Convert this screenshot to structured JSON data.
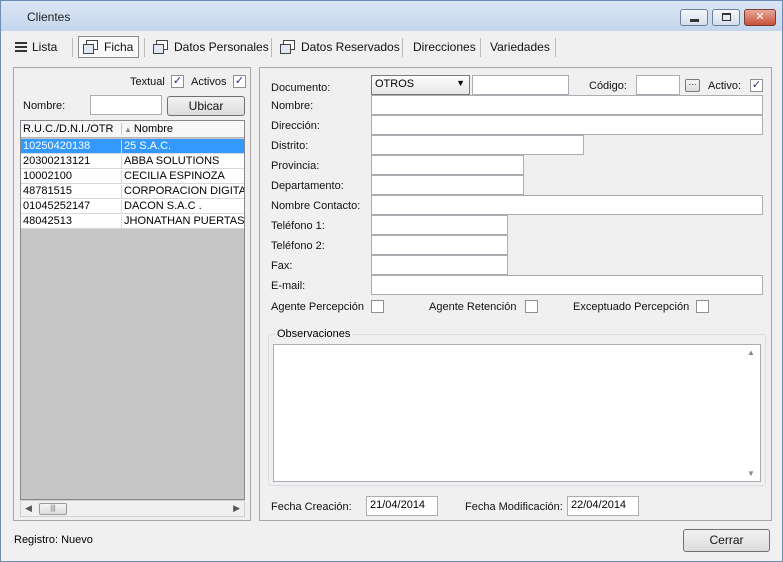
{
  "window": {
    "title": "Clientes"
  },
  "toolbar": {
    "tabs": [
      {
        "label": "Lista"
      },
      {
        "label": "Ficha"
      },
      {
        "label": "Datos Personales"
      },
      {
        "label": "Datos Reservados"
      },
      {
        "label": "Direcciones"
      },
      {
        "label": "Variedades"
      }
    ]
  },
  "search": {
    "textual_label": "Textual",
    "textual_checked": "✓",
    "activos_label": "Activos",
    "activos_checked": "✓",
    "nombre_label": "Nombre:",
    "nombre_value": "",
    "ubicar_label": "Ubicar"
  },
  "grid": {
    "columns": [
      "R.U.C./D.N.I./OTR",
      "Nombre"
    ],
    "sort_glyph": "▲",
    "rows": [
      {
        "doc": "10250420138",
        "name": "25 S.A.C."
      },
      {
        "doc": "20300213121",
        "name": "ABBA SOLUTIONS"
      },
      {
        "doc": "10002100",
        "name": "CECILIA ESPINOZA"
      },
      {
        "doc": "48781515",
        "name": "CORPORACION DIGITAX"
      },
      {
        "doc": "01045252147",
        "name": "DACON S.A.C ."
      },
      {
        "doc": "48042513",
        "name": "JHONATHAN PUERTAS"
      }
    ],
    "selected_index": 0
  },
  "form": {
    "documento_label": "Documento:",
    "documento_value": "OTROS",
    "documento_number": "",
    "codigo_label": "Código:",
    "codigo_value": "",
    "activo_label": "Activo:",
    "activo_checked": "✓",
    "nombre_label": "Nombre:",
    "direccion_label": "Dirección:",
    "distrito_label": "Distrito:",
    "provincia_label": "Provincia:",
    "departamento_label": "Departamento:",
    "contacto_label": "Nombre Contacto:",
    "telefono1_label": "Teléfono 1:",
    "telefono2_label": "Teléfono 2:",
    "fax_label": "Fax:",
    "email_label": "E-mail:",
    "agente_percepcion_label": "Agente Percepción",
    "agente_retencion_label": "Agente Retención",
    "exceptuado_label": "Exceptuado Percepción",
    "observaciones_label": "Observaciones",
    "fecha_creacion_label": "Fecha Creación:",
    "fecha_creacion_value": "21/04/2014",
    "fecha_modificacion_label": "Fecha Modificación:",
    "fecha_modificacion_value": "22/04/2014"
  },
  "status": {
    "text": "Registro: Nuevo"
  },
  "footer": {
    "cerrar_label": "Cerrar"
  }
}
